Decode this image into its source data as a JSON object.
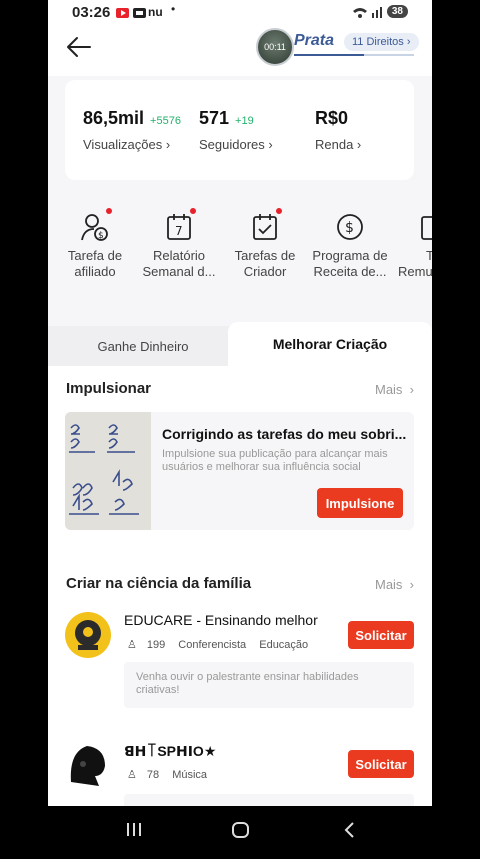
{
  "status": {
    "time": "03:26",
    "carrier": "nu",
    "battery": "38"
  },
  "header": {
    "tier": "Prata",
    "rights": "11 Direitos",
    "avatar_time": "00:11"
  },
  "stats": [
    {
      "value": "86,5mil",
      "delta": "+5576",
      "label": "Visualizações ›"
    },
    {
      "value": "571",
      "delta": "+19",
      "label": "Seguidores ›"
    },
    {
      "value": "R$0",
      "delta": "",
      "label": "Renda ›"
    }
  ],
  "tools": [
    {
      "label1": "Tarefa de",
      "label2": "afiliado",
      "icon": "affiliate-icon",
      "dot": true
    },
    {
      "label1": "Relatório",
      "label2": "Semanal d...",
      "icon": "calendar-7-icon",
      "dot": true
    },
    {
      "label1": "Tarefas de",
      "label2": "Criador",
      "icon": "calendar-check-icon",
      "dot": true
    },
    {
      "label1": "Programa de",
      "label2": "Receita de...",
      "icon": "dollar-circle-icon",
      "dot": false
    },
    {
      "label1": "Ta",
      "label2": "Remu",
      "icon": "task-icon",
      "dot": false
    }
  ],
  "tabs": {
    "left": "Ganhe Dinheiro",
    "right": "Melhorar Criação"
  },
  "boost_section": {
    "title": "Impulsionar",
    "more": "Mais",
    "card_title": "Corrigindo as tarefas do meu sobri...",
    "card_desc": "Impulsione sua publicação para alcançar mais usuários e melhorar sua influência social",
    "button": "Impulsione"
  },
  "family_section": {
    "title": "Criar na ciência da família",
    "more": "Mais",
    "creators": [
      {
        "name": "EDUCARE - Ensinando melhor",
        "followers": "199",
        "tag1": "Conferencista",
        "tag2": "Educação",
        "desc": "Venha ouvir o palestrante ensinar habilidades criativas!",
        "button": "Solicitar"
      },
      {
        "name": "ꓭꓧ꓄SPꓧꓲO★",
        "followers": "78",
        "tag1": "Música",
        "tag2": "",
        "desc": "",
        "button": "Solicitar"
      }
    ]
  },
  "colors": {
    "accent": "#ea3a1f",
    "tier": "#3c5b96",
    "delta": "#20b26b"
  }
}
